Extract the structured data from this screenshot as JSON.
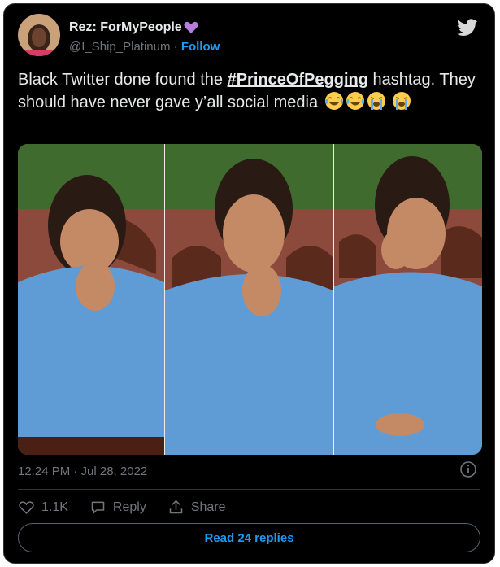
{
  "author": {
    "display_name": "Rez: ForMyPeople",
    "handle": "@I_Ship_Platinum",
    "separator": " · ",
    "follow_label": "Follow"
  },
  "tweet": {
    "text_before": "Black Twitter done found the ",
    "hashtag": "#PrinceOfPegging",
    "text_after": " hashtag. They should have never gave y’all social media"
  },
  "meta": {
    "timestamp": "12:24 PM · Jul 28, 2022"
  },
  "actions": {
    "like_count": "1.1K",
    "reply_label": "Reply",
    "share_label": "Share"
  },
  "read_replies_label": "Read 24 replies",
  "colors": {
    "background": "#000000",
    "accent": "#1d9bf0",
    "muted": "#71767b",
    "text": "#e7e9ea",
    "heart_emoji": "#b57edc"
  },
  "icons": {
    "heart_emoji": "purple-heart-icon",
    "brand": "twitter-bird-icon",
    "emojis": [
      "tears-of-joy-emoji",
      "tears-of-joy-emoji",
      "loudly-crying-emoji",
      "loudly-crying-emoji"
    ],
    "info": "info-icon",
    "like": "heart-outline-icon",
    "reply": "speech-bubble-icon",
    "share": "share-upload-icon"
  }
}
